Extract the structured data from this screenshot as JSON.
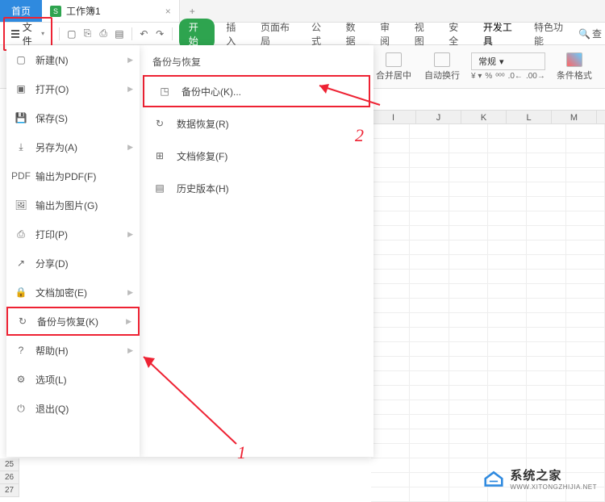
{
  "tabs": {
    "home": "首页",
    "doc_badge": "S",
    "doc_name": "工作簿1",
    "close": "×",
    "plus": "+"
  },
  "file_button": "文件",
  "toolbar": {
    "start_pill": "开始",
    "menu": [
      "插入",
      "页面布局",
      "公式",
      "数据",
      "审阅",
      "视图",
      "安全",
      "开发工具",
      "特色功能"
    ],
    "search_icon": "🔍",
    "search_text": "查"
  },
  "ribbon": {
    "merge": "合并居中",
    "wrap": "自动换行",
    "format_dd": "常规",
    "cond_format": "条件格式",
    "dd_arrow": "▾"
  },
  "menu": {
    "items": [
      {
        "label": "新建(N)",
        "arrow": true
      },
      {
        "label": "打开(O)",
        "arrow": true
      },
      {
        "label": "保存(S)",
        "arrow": false
      },
      {
        "label": "另存为(A)",
        "arrow": true
      },
      {
        "label": "输出为PDF(F)",
        "arrow": false
      },
      {
        "label": "输出为图片(G)",
        "arrow": false
      },
      {
        "label": "打印(P)",
        "arrow": true
      },
      {
        "label": "分享(D)",
        "arrow": false
      },
      {
        "label": "文档加密(E)",
        "arrow": true
      },
      {
        "label": "备份与恢复(K)",
        "arrow": true,
        "highlight": true
      },
      {
        "label": "帮助(H)",
        "arrow": true
      },
      {
        "label": "选项(L)",
        "arrow": false
      },
      {
        "label": "退出(Q)",
        "arrow": false
      }
    ]
  },
  "submenu": {
    "title": "备份与恢复",
    "items": [
      {
        "label": "备份中心(K)...",
        "highlight": true
      },
      {
        "label": "数据恢复(R)",
        "highlight": false
      },
      {
        "label": "文档修复(F)",
        "highlight": false
      },
      {
        "label": "历史版本(H)",
        "highlight": false
      }
    ]
  },
  "cols": [
    "I",
    "J",
    "K",
    "L",
    "M"
  ],
  "row_nums": [
    "25",
    "26",
    "27"
  ],
  "annotations": {
    "num1": "1",
    "num2": "2"
  },
  "watermark": {
    "cn": "系统之家",
    "en": "WWW.XITONGZHIJIA.NET"
  }
}
